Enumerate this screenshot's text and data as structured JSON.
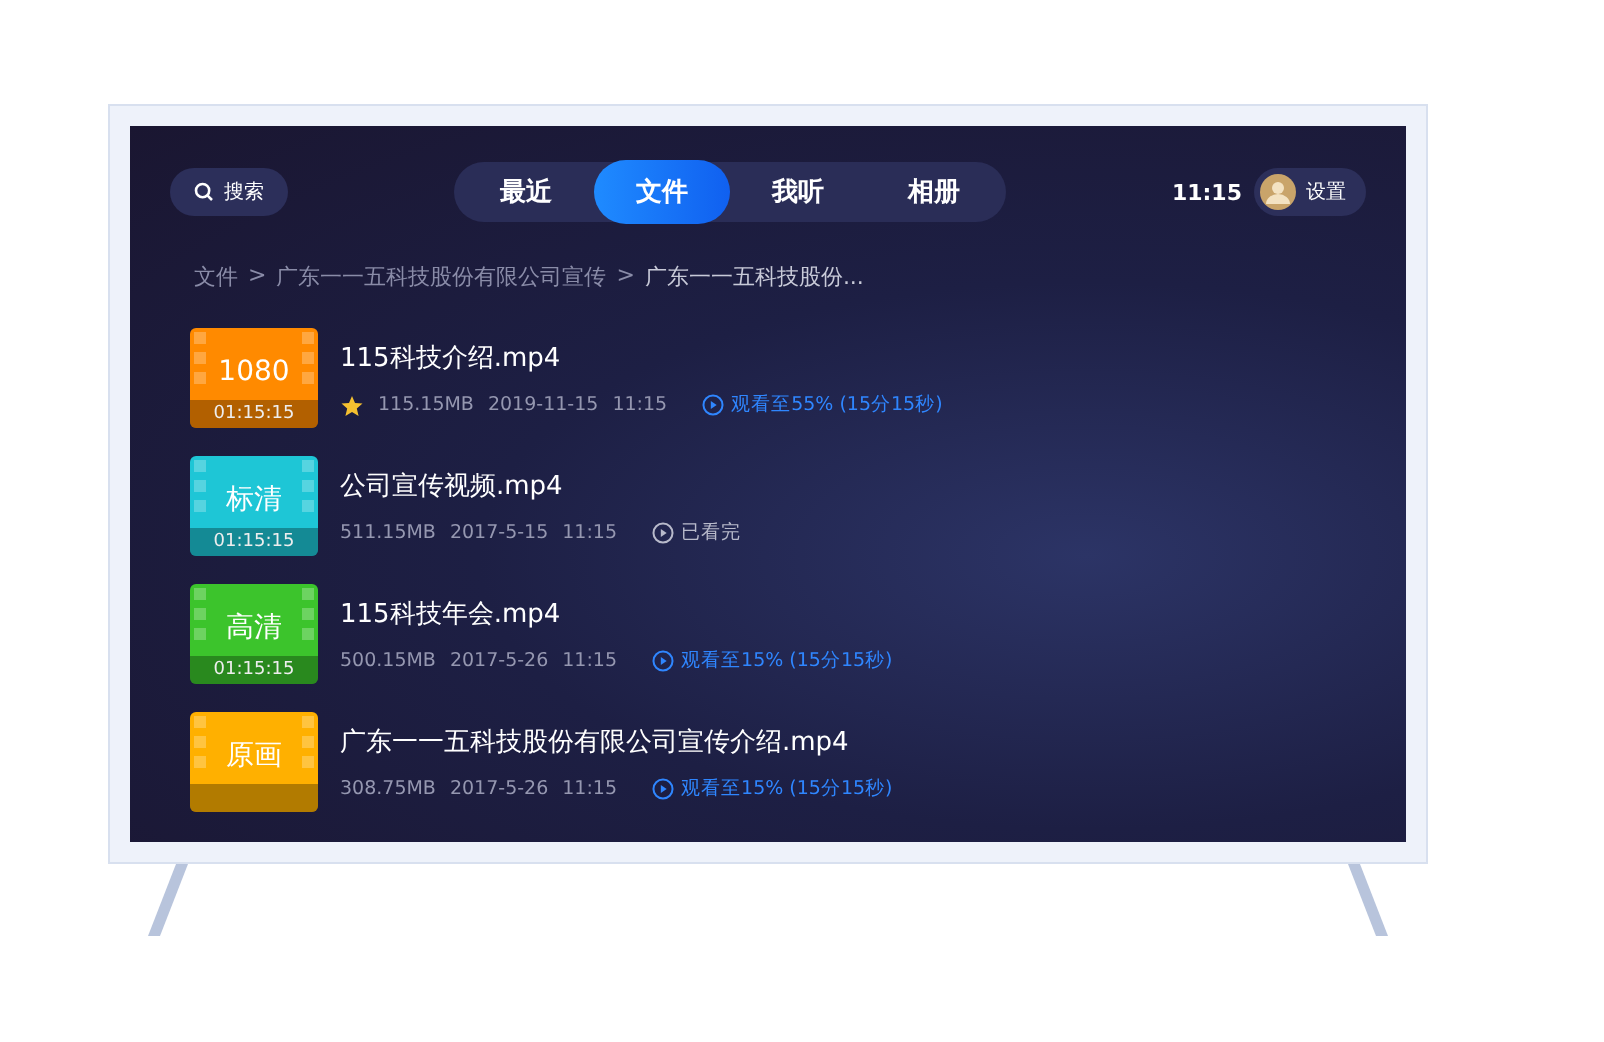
{
  "search": {
    "label": "搜索"
  },
  "tabs": [
    {
      "label": "最近",
      "selected": false
    },
    {
      "label": "文件",
      "selected": true
    },
    {
      "label": "我听",
      "selected": false
    },
    {
      "label": "相册",
      "selected": false
    }
  ],
  "clock": "11:15",
  "settings": {
    "label": "设置"
  },
  "breadcrumb": [
    "文件",
    "广东一一五科技股份有限公司宣传",
    "广东一一五科技股份..."
  ],
  "breadcrumb_separator": ">",
  "files": [
    {
      "badge": "1080",
      "duration": "01:15:15",
      "color": "#ff8a00",
      "name": "115科技介绍.mp4",
      "starred": true,
      "size": "115.15MB",
      "date": "2019-11-15",
      "time": "11:15",
      "kind": "progress",
      "status": "观看至55% (15分15秒)"
    },
    {
      "badge": "标清",
      "duration": "01:15:15",
      "color": "#1ec6d6",
      "name": "公司宣传视频.mp4",
      "starred": false,
      "size": "511.15MB",
      "date": "2017-5-15",
      "time": "11:15",
      "kind": "done",
      "status": "已看完"
    },
    {
      "badge": "高清",
      "duration": "01:15:15",
      "color": "#3cc42c",
      "name": "115科技年会.mp4",
      "starred": false,
      "size": "500.15MB",
      "date": "2017-5-26",
      "time": "11:15",
      "kind": "progress",
      "status": "观看至15% (15分15秒)"
    },
    {
      "badge": "原画",
      "color": "#ffb000",
      "name": "广东一一五科技股份有限公司宣传介绍.mp4",
      "starred": false,
      "size": "308.75MB",
      "date": "2017-5-26",
      "time": "11:15",
      "kind": "progress",
      "status": "观看至15% (15分15秒)"
    }
  ]
}
